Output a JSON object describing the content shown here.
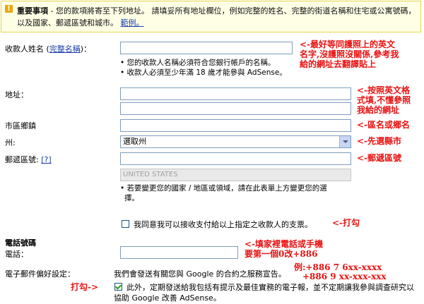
{
  "notice": {
    "title": "重要事項",
    "body": " - 您的款項將寄至下列地址。 請填妥所有地址欄位，例如完整的姓名、完整的街道名稱和住宅或公寓號碼，以及國家、郵遞區號和城市。",
    "example_link": "範例。"
  },
  "payee": {
    "label_prefix": "收款人姓名 (",
    "label_link": "完整名稱",
    "label_suffix": ")：",
    "hint1": "• 您的收款人名稱必須符合您銀行帳戶的名稱。",
    "hint2": "• 收款人必須至少年滿 18 歲才能參與 AdSense。"
  },
  "address": {
    "label": "地址："
  },
  "city": {
    "label": "市區鄉鎮"
  },
  "state": {
    "label": "州:",
    "selected": "選取州"
  },
  "zip": {
    "label": "郵遞區號:",
    "help": "[?]"
  },
  "country": {
    "value": "UNITED STATES",
    "hint1": "• 若要變更您的國家 / 地區或領域，請在此表單上方變更您的選",
    "hint2": "擇。"
  },
  "agree": {
    "label": "我同意我可以接收支付給以上指定之收款人的支票。"
  },
  "phone_section": {
    "title": "電話號碼",
    "label": "電話："
  },
  "email_pref": {
    "label": "電子郵件偏好設定：",
    "line1": "我們會發送有關您與 Google 的合約之服務宣告。",
    "opt_line1": "此外，定期發送給我包括有提示及最佳實務的電子報，並不定期讓我參與調查研究以",
    "opt_line2": "協助 Google 改善 AdSense。"
  },
  "annotations": {
    "name_note": [
      "<-最好等同護照上的英文",
      "名字,沒護照沒關係,參考我",
      "給的網址去翻譯貼上"
    ],
    "address_note": [
      "<-按照英文格",
      "式填,不懂參照",
      "我給的網址"
    ],
    "city_note": "<-區名或鄉名",
    "state_note": "<-先選縣市",
    "zip_note": "<-郵遞區號",
    "agree_note": "<-打勾",
    "phone_note": [
      "<-填家裡電話或手機",
      "要第一個0改+886"
    ],
    "phone_example": [
      "例:+886 7 6xx-xxxx",
      "+886 9 xx-xxx-xxx"
    ],
    "checkbox_note": "打勾->"
  },
  "colors": {
    "annotation": "#e81212",
    "link": "#1a3caa",
    "notice_bg": "#ffffe6",
    "notice_border": "#e6d64c"
  }
}
